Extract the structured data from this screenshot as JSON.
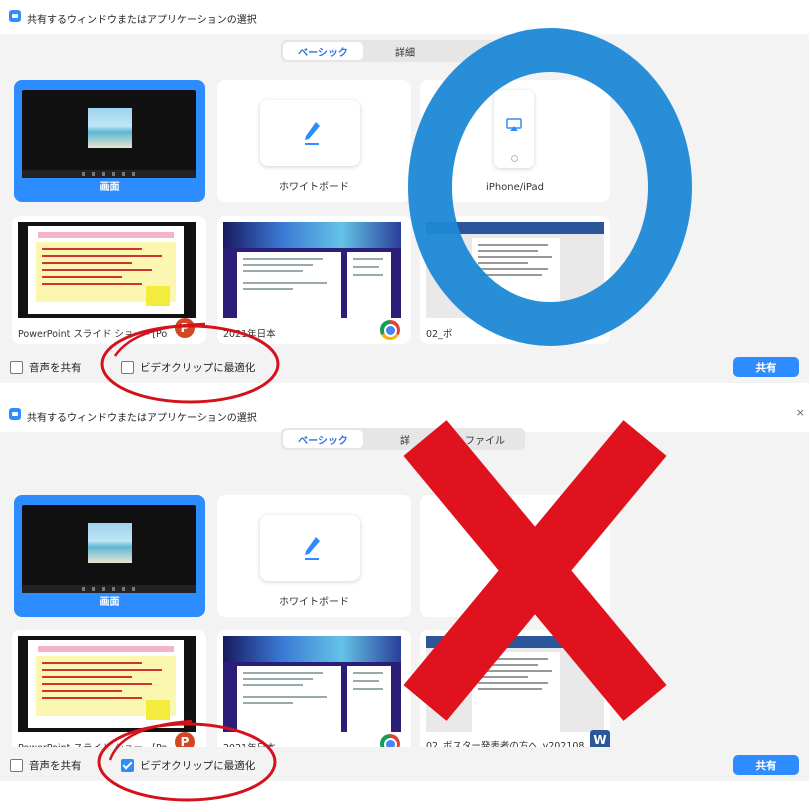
{
  "window_title": "共有するウィンドウまたはアプリケーションの選択",
  "accent_color": "#2d8cff",
  "top_panel": {
    "tabs": [
      "ベーシック",
      "詳細"
    ],
    "active_tab": "ベーシック",
    "tiles": {
      "screen": "画面",
      "whiteboard": "ホワイトボード",
      "iphone": "iPhone/iPad"
    },
    "docs": [
      {
        "caption": "PowerPoint スライド ショー - [Poster...",
        "app": "P"
      },
      {
        "caption": "2021年日本",
        "app": "chrome"
      },
      {
        "caption": "02_ポ",
        "app": ""
      }
    ],
    "footer": {
      "share_audio": "音声を共有",
      "optimize_video": "ビデオクリップに最適化",
      "optimize_checked": false,
      "share_button": "共有"
    },
    "overlay": "blue-circle-correct-mark"
  },
  "bottom_panel": {
    "tabs": [
      "ベーシック",
      "詳",
      "ファイル"
    ],
    "active_tab": "ベーシック",
    "tiles": {
      "screen": "画面",
      "whiteboard": "ホワイトボード"
    },
    "docs": [
      {
        "caption": "PowerPoint スライド ショー - [Poster...",
        "app": "P"
      },
      {
        "caption": "2021年日本",
        "app": "chrome"
      },
      {
        "caption": "02_ポスター発表者の方へ_v202108...",
        "app": "W"
      }
    ],
    "footer": {
      "share_audio": "音声を共有",
      "optimize_video": "ビデオクリップに最適化",
      "optimize_checked": true,
      "share_button": "共有"
    },
    "overlay": "red-x-wrong-mark"
  },
  "close_glyph": "×"
}
